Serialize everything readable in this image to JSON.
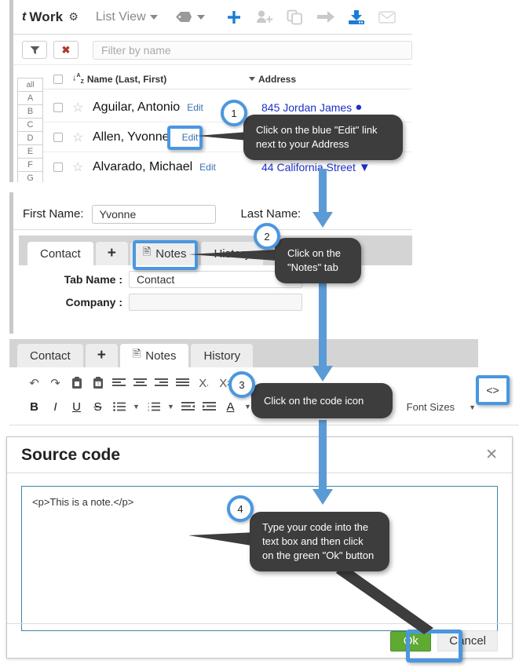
{
  "app": {
    "logo": "t",
    "title": "Work",
    "gear_icon": "gear-icon",
    "list_view_label": "List View",
    "tag_icon": "tag-icon",
    "icons": [
      "plus-icon",
      "add-user-icon",
      "duplicate-icon",
      "arrow-right-icon",
      "download-icon",
      "envelope-icon"
    ]
  },
  "filter": {
    "funnel_icon": "funnel-icon",
    "clear_icon": "clear-x-icon",
    "placeholder": "Filter by name"
  },
  "alpha_rail": [
    "all",
    "A",
    "B",
    "C",
    "D",
    "E",
    "F",
    "G"
  ],
  "table": {
    "headers": {
      "name": "Name (Last, First)",
      "address": "Address",
      "sort_icon": "sort-az-icon"
    },
    "rows": [
      {
        "name": "Aguilar, Antonio",
        "edit": "Edit",
        "address": "845 Jordan James"
      },
      {
        "name": "Allen, Yvonne",
        "edit": "Edit",
        "address": ""
      },
      {
        "name": "Alvarado, Michael",
        "edit": "Edit",
        "address": "44 California Street"
      }
    ]
  },
  "form": {
    "first_name_label": "First Name:",
    "first_name_value": "Yvonne",
    "last_name_label": "Last Name:",
    "tabs": [
      "Contact",
      "+",
      "Notes",
      "History"
    ],
    "tab_name_label": "Tab Name :",
    "tab_name_value": "Contact",
    "company_label": "Company :",
    "company_value": ""
  },
  "editor": {
    "tabs": [
      "Contact",
      "+",
      "Notes",
      "History"
    ],
    "toolbar_row1": [
      "undo-icon",
      "redo-icon",
      "paste-icon",
      "paste-text-icon",
      "align-left-icon",
      "align-center-icon",
      "align-right-icon",
      "align-justify-icon",
      "subscript-icon",
      "superscript-icon"
    ],
    "toolbar_row2": [
      "bold-icon",
      "italic-icon",
      "underline-icon",
      "strikethrough-icon",
      "bullet-list-icon",
      "caret-down-icon",
      "numbered-list-icon",
      "caret-down-icon",
      "outdent-icon",
      "indent-icon",
      "text-color-icon",
      "caret-down-icon"
    ],
    "font_sizes_label": "Font Sizes",
    "code_icon": "code-icon",
    "bold_b": "B",
    "italic_i": "I",
    "underline_u": "U",
    "strike_s": "S",
    "text_a": "A",
    "sub": "X",
    "sup": "X"
  },
  "dialog": {
    "title": "Source code",
    "close_icon": "close-icon",
    "code_value": "<p>This is a note.</p>",
    "ok_label": "Ok",
    "cancel_label": "Cancel"
  },
  "steps": [
    {
      "number": "1",
      "text_line1": "Click on the blue \"Edit\" link",
      "text_line2": "next to your Address"
    },
    {
      "number": "2",
      "text_line1": "Click on the",
      "text_line2": "\"Notes\" tab"
    },
    {
      "number": "3",
      "text_line1": "Click on the code icon",
      "text_line2": ""
    },
    {
      "number": "4",
      "text_line1": "Type your code into the",
      "text_line2": "text box and then click",
      "text_line3": "on the green \"Ok\" button"
    }
  ],
  "colors": {
    "highlight_blue": "#4a97e0",
    "callout_dark": "#3d3d3d",
    "ok_green": "#5faa33",
    "link_blue": "#1b32c8",
    "accent_blue": "#1a7fd4"
  }
}
